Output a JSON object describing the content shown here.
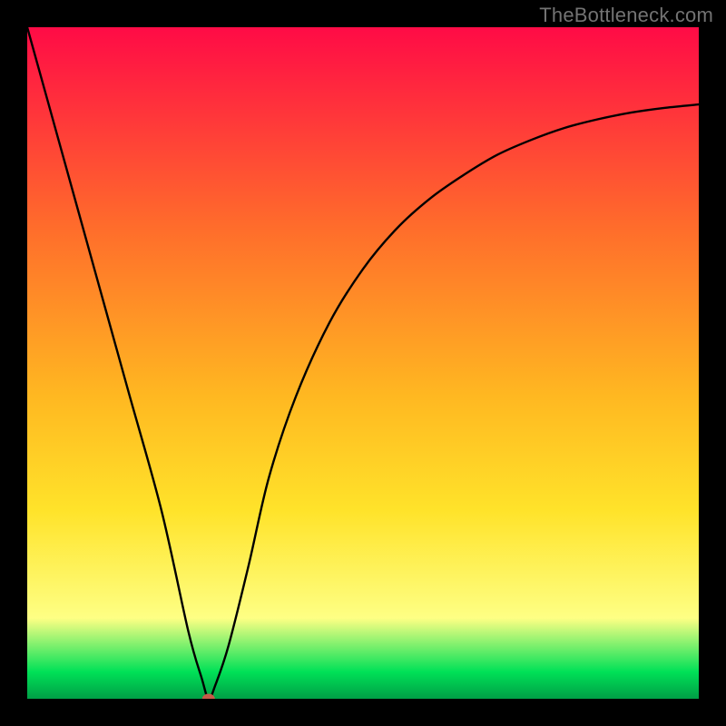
{
  "watermark": "TheBottleneck.com",
  "colors": {
    "background": "#000000",
    "watermark": "#737373",
    "curve": "#000000",
    "marker": "#c85a48",
    "gradient_top": "#ff0b46",
    "gradient_upper": "#ff6d2b",
    "gradient_mid": "#ffb821",
    "gradient_lower_mid": "#ffe32a",
    "gradient_pale": "#feff84",
    "gradient_green": "#00e157",
    "gradient_deep_green": "#009e46"
  },
  "chart_data": {
    "type": "line",
    "title": "",
    "xlabel": "",
    "ylabel": "",
    "xlim": [
      0,
      100
    ],
    "ylim": [
      0,
      100
    ],
    "grid": false,
    "legend": false,
    "series": [
      {
        "name": "bottleneck-curve",
        "x": [
          0,
          5,
          10,
          15,
          20,
          24,
          26,
          27,
          28,
          30,
          33,
          36,
          40,
          45,
          50,
          55,
          60,
          65,
          70,
          75,
          80,
          85,
          90,
          95,
          100
        ],
        "y": [
          100,
          82,
          64,
          46,
          28,
          10,
          3,
          0,
          2,
          8,
          20,
          33,
          45,
          56,
          64,
          70,
          74.5,
          78,
          81,
          83.2,
          85,
          86.3,
          87.3,
          88,
          88.5
        ]
      }
    ],
    "marker": {
      "x": 27,
      "y": 0,
      "radius_pct": 0.9
    },
    "note": "Values estimated from pixel positions; chart has no axis ticks or labels."
  }
}
